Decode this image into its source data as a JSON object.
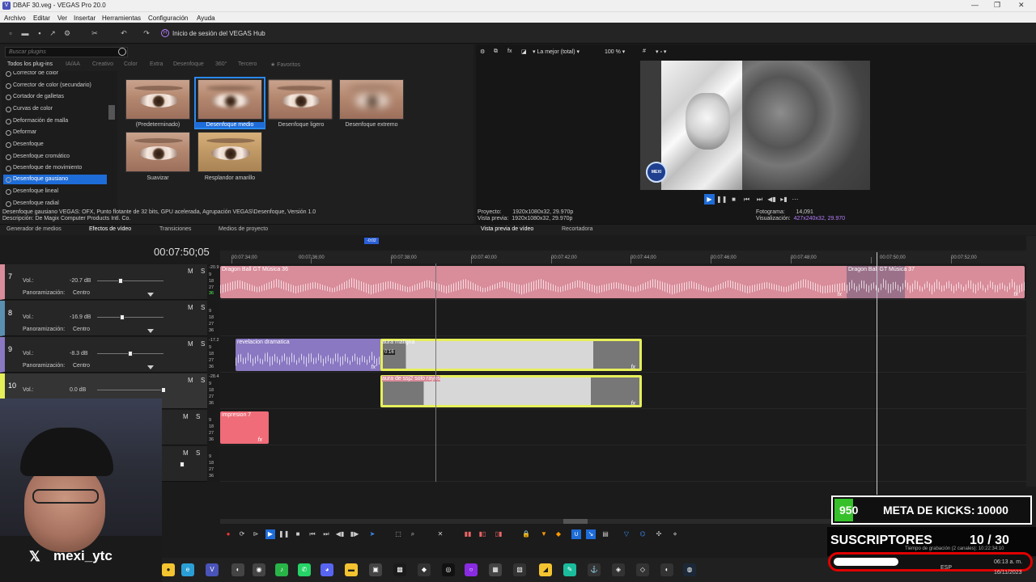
{
  "window": {
    "title": "DBAF 30.veg - VEGAS Pro 20.0"
  },
  "menu": [
    "Archivo",
    "Editar",
    "Ver",
    "Insertar",
    "Herramientas",
    "Configuración",
    "Ayuda"
  ],
  "toolbar": {
    "hub_label": "Inicio de sesión del VEGAS Hub"
  },
  "plugins": {
    "search_placeholder": "Buscar plugins",
    "tabs": [
      "Todos los plug-ins",
      "IA/AA",
      "Creativo",
      "Color",
      "Extra",
      "Desenfoque",
      "360°",
      "Tercero",
      "Favoritos"
    ],
    "list": [
      "Corrector de color",
      "Corrector de color (secundario)",
      "Cortador de galletas",
      "Curvas de color",
      "Deformación de malla",
      "Deformar",
      "Desenfoque",
      "Desenfoque cromático",
      "Desenfoque de movimiento",
      "Desenfoque gausiano",
      "Desenfoque lineal",
      "Desenfoque radial"
    ],
    "selected": "Desenfoque gausiano",
    "presets": [
      "(Predeterminado)",
      "Desenfoque medio",
      "Desenfoque ligero",
      "Desenfoque extremo",
      "Suavizar",
      "Resplandor amarillo"
    ],
    "selected_preset": "Desenfoque medio",
    "desc_line1": "Desenfoque gausiano VEGAS: OFX, Punto flotante de 32 bits, GPU acelerada, Agrupación VEGAS\\Desenfoque, Versión 1.0",
    "desc_line2": "Descripción: De Magix Computer Products Intl. Co."
  },
  "preview": {
    "quality": "La mejor (total)",
    "zoom": "100 %",
    "watermark": "MEXI",
    "project_label": "Proyecto:",
    "project_value": "1920x1080x32, 29.970p",
    "preview_label": "Vista previa:",
    "preview_value": "1920x1080x32, 29.970p",
    "frame_label": "Fotograma:",
    "frame_value": "14,091",
    "display_label": "Visualización:",
    "display_value": "427x240x32, 29.970"
  },
  "tabs_left": [
    "Generador de medios",
    "Efectos de vídeo",
    "Transiciones",
    "Medios de proyecto"
  ],
  "tabs_right": [
    "Vista previa de vídeo",
    "Recortadora"
  ],
  "timeline": {
    "timecode": "00:07:50;05",
    "loop_marker": "-0:02",
    "ruler_labels": [
      "00:07:34;00",
      "00:07:36;00",
      "00:07:38;00",
      "00:07:40;00",
      "00:07:42;00",
      "00:07:44;00",
      "00:07:46;00",
      "00:07:48;00",
      "00:07:50;00",
      "00:07:52;00"
    ],
    "meter_ticks": [
      "9",
      "18",
      "27",
      "36"
    ],
    "mute": "M",
    "solo": "S",
    "vol_label": "Vol.:",
    "pan_label": "Panoramización:",
    "fx_label": "fx",
    "tracks": [
      {
        "num": "7",
        "vol": "-20.7 dB",
        "pan": "Centro",
        "peak": "-20.9"
      },
      {
        "num": "8",
        "vol": "-16.9 dB",
        "pan": "Centro",
        "peak": ""
      },
      {
        "num": "9",
        "vol": "-8.3 dB",
        "pan": "Centro",
        "peak": "-17.2"
      },
      {
        "num": "10",
        "vol": "0.0 dB",
        "pan": "",
        "peak": "-28.4"
      },
      {
        "num": "",
        "vol": "",
        "pan": "",
        "peak": ""
      },
      {
        "num": "",
        "vol": "",
        "pan": "",
        "peak": ""
      }
    ],
    "clips": {
      "dbgt1": "Dragon Ball GT Música 36",
      "dbgt2": "Dragon Ball GT Música 37",
      "revelacion": "revelacion dramatica",
      "aura": "aura maligna",
      "aura2": "aura de ssj2 solo rayos",
      "impresion": "impresion 7",
      "aura_badge": "0:16"
    }
  },
  "overlay": {
    "handle": "mexi_ytc",
    "x_logo": "𝕏",
    "kicks_count": "950",
    "kicks_meta_label": "META DE KICKS:",
    "kicks_goal": "10000",
    "kicks_progress": 0.095,
    "subs_label": "SUSCRIPTORES",
    "subs_value": "10 / 30",
    "subs_progress": 0.333,
    "rec_info": "Tiempo de grabación (2 canales): 10:22:34:10"
  },
  "taskbar": {
    "lang": "ESP",
    "time": "06:13 a. m.",
    "date": "16/11/2023"
  },
  "colors": {
    "selection": "#1e6cd8",
    "music_clip": "#d98c9a",
    "video_clip": "#8a78c2",
    "aura_clip": "#e6ef5a",
    "impresion_clip": "#ef6c78",
    "kicks_green": "#36c12a",
    "subs_border": "#e10000"
  }
}
